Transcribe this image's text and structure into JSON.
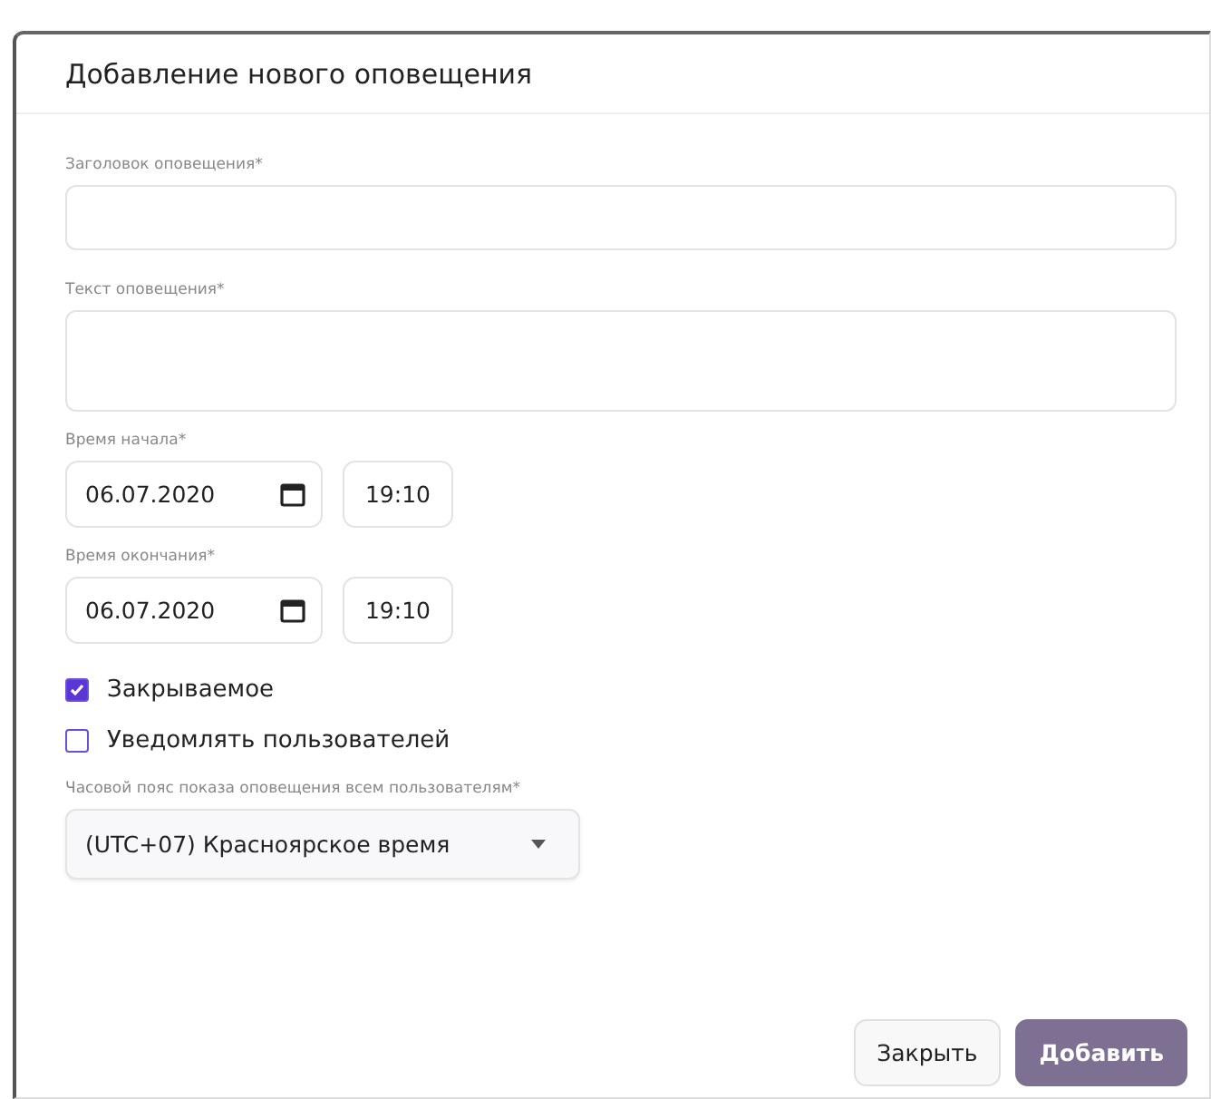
{
  "dialog": {
    "title": "Добавление нового оповещения"
  },
  "title_field": {
    "label": "Заголовок оповещения*"
  },
  "text_field": {
    "label": "Текст оповещения*"
  },
  "start": {
    "label": "Время начала*",
    "date": "06.07.2020",
    "time": "19:10"
  },
  "end": {
    "label": "Время окончания*",
    "date": "06.07.2020",
    "time": "19:10"
  },
  "checkboxes": [
    {
      "label": "Закрываемое",
      "checked": true
    },
    {
      "label": "Уведомлять пользователей",
      "checked": false
    }
  ],
  "timezone": {
    "label": "Часовой пояс показа оповещения всем пользователям*",
    "value": "(UTC+07) Красноярское время"
  },
  "buttons": [
    {
      "label": "Закрыть",
      "kind": "secondary"
    },
    {
      "label": "Добавить",
      "kind": "primary"
    }
  ]
}
